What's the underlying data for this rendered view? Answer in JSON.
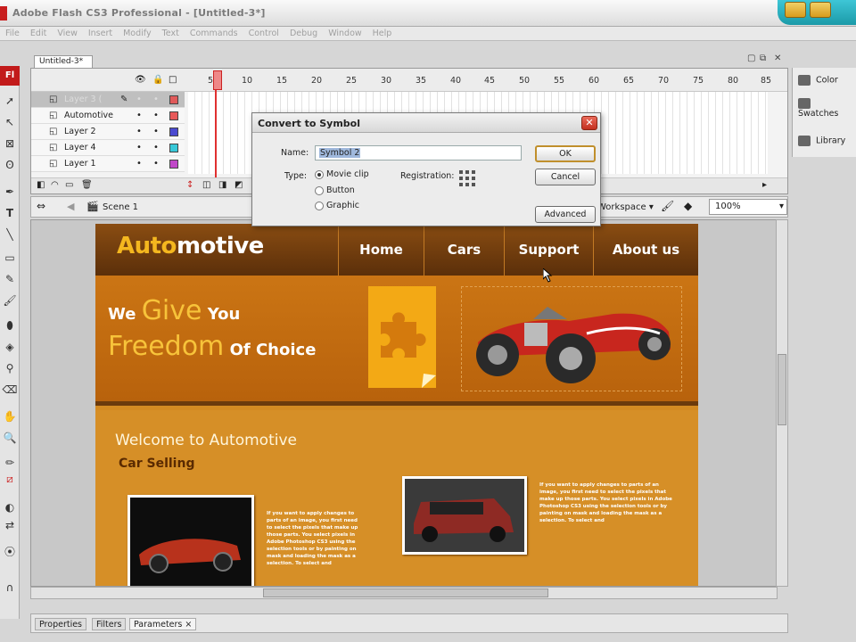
{
  "window": {
    "title": "Adobe Flash CS3 Professional - [Untitled-3*]",
    "app_badge": "Fl"
  },
  "menu": [
    "File",
    "Edit",
    "View",
    "Insert",
    "Modify",
    "Text",
    "Commands",
    "Control",
    "Debug",
    "Window",
    "Help"
  ],
  "document_tab": "Untitled-3*",
  "timeline": {
    "frame_numbers": [
      "5",
      "10",
      "15",
      "20",
      "25",
      "30",
      "35",
      "40",
      "45",
      "50",
      "55",
      "60",
      "65",
      "70",
      "75",
      "80",
      "85"
    ],
    "layers": [
      {
        "name": "Layer 3 (",
        "color": "#e05a5a",
        "active": true
      },
      {
        "name": "Automotive",
        "color": "#e85a5a",
        "active": false
      },
      {
        "name": "Layer 2",
        "color": "#4a4ad0",
        "active": false
      },
      {
        "name": "Layer 4",
        "color": "#38c8d8",
        "active": false
      },
      {
        "name": "Layer 1",
        "color": "#c048c8",
        "active": false
      }
    ]
  },
  "editbar": {
    "scene": "Scene 1",
    "workspace": "Workspace ▾",
    "zoom": "100%"
  },
  "stage_site": {
    "logo_part1": "Auto",
    "logo_part2": "motive",
    "nav": [
      "Home",
      "Cars",
      "Support",
      "About us"
    ],
    "tagline_line1_pre": "We ",
    "tagline_line1_big": "Give",
    "tagline_line1_post": " You",
    "tagline_line2_big": "Freedom",
    "tagline_line2_post": " Of Choice",
    "welcome": "Welcome to Automotive",
    "subheading": "Car Selling",
    "blurb_left": "If you want to apply changes to parts of an image, you first need to select the pixels that make up those parts. You select pixels in Adobe Photoshop CS3 using the selection tools or by painting on mask and loading the mask as a selection. To select and",
    "blurb_right": "If you want to apply changes to parts of an image, you first need to select the pixels that make up those parts. You select pixels in Adobe Photoshop CS3 using the selection tools or by painting on mask and loading the mask as a selection. To select and"
  },
  "right_panels": [
    "Color",
    "Swatches",
    "Library"
  ],
  "bottom_tabs": [
    "Properties",
    "Filters",
    "Parameters ×"
  ],
  "dialog": {
    "title": "Convert to Symbol",
    "name_label": "Name:",
    "name_value": "Symbol 2",
    "type_label": "Type:",
    "types": [
      "Movie clip",
      "Button",
      "Graphic"
    ],
    "selected_type": "Movie clip",
    "registration_label": "Registration:",
    "ok": "OK",
    "cancel": "Cancel",
    "advanced": "Advanced"
  },
  "colors": {
    "site_orange": "#d38a22",
    "site_brown": "#5b2f0a",
    "logo_yellow": "#f4b71f",
    "flash_red": "#c21a1a"
  }
}
